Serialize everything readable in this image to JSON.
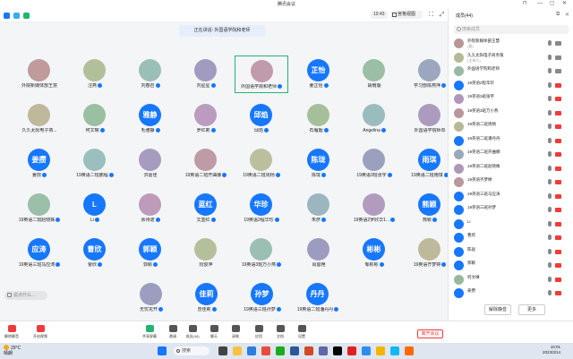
{
  "window": {
    "title": "腾讯会议"
  },
  "toolbar": {
    "timer": "10:43",
    "view_label": "宫格视图"
  },
  "speaking_banner": "正在讲话: 外国语学院和老师",
  "grid": {
    "rows": [
      [
        {
          "name": "外院新媒体部王慧",
          "avatar": "img",
          "hand": false
        },
        {
          "name": "汪燕",
          "avatar": "img",
          "hand": true
        },
        {
          "name": "刘春召",
          "avatar": "img",
          "hand": true
        },
        {
          "name": "刘星星",
          "avatar": "img",
          "hand": true
        },
        {
          "name": "外国语学院和老师",
          "avatar": "img",
          "hand": true,
          "selected": true
        },
        {
          "name": "姜芷怡",
          "avatar": "芷怡",
          "hand": true
        },
        {
          "name": "胡雨璇",
          "avatar": "img",
          "hand": false
        },
        {
          "name": "学习部陈燕萍",
          "avatar": "img",
          "hand": true
        }
      ],
      [
        {
          "name": "久久太阳电子商...",
          "avatar": "img",
          "hand": false
        },
        {
          "name": "何文琳",
          "avatar": "img",
          "hand": true
        },
        {
          "name": "毛雅静",
          "avatar": "雅静",
          "hand": true
        },
        {
          "name": "罗红莉",
          "avatar": "img",
          "hand": true
        },
        {
          "name": "邱焰",
          "avatar": "邱焰",
          "hand": true
        },
        {
          "name": "石雁姻",
          "avatar": "img",
          "hand": true
        },
        {
          "name": "Angelina",
          "avatar": "img",
          "hand": true
        },
        {
          "name": "外国语学院师邓",
          "avatar": "img",
          "hand": false
        }
      ],
      [
        {
          "name": "姜攒",
          "avatar": "姜攒",
          "hand": true
        },
        {
          "name": "19英语二班鹏程",
          "avatar": "img",
          "hand": true
        },
        {
          "name": "洪嘉佳",
          "avatar": "img",
          "hand": false
        },
        {
          "name": "19英语二班开曲娜",
          "avatar": "img",
          "hand": true
        },
        {
          "name": "19英语二班周杨",
          "avatar": "img",
          "hand": true
        },
        {
          "name": "陈珑",
          "avatar": "陈珑",
          "hand": true
        },
        {
          "name": "19英语3班张宇",
          "avatar": "img",
          "hand": true
        },
        {
          "name": "19英语二班雨琪",
          "avatar": "雨琪",
          "hand": true
        }
      ],
      [
        {
          "name": "19英语二班赵晓姝",
          "avatar": "img",
          "hand": true
        },
        {
          "name": "Li",
          "avatar": "L",
          "hand": true
        },
        {
          "name": "余诗诺",
          "avatar": "img",
          "hand": true
        },
        {
          "name": "文蓝红",
          "avatar": "蓝红",
          "hand": true
        },
        {
          "name": "19英语2程华珍",
          "avatar": "华珍",
          "hand": true
        },
        {
          "name": "朱彦",
          "avatar": "img",
          "hand": true
        },
        {
          "name": "19英语2罗欣华1...",
          "avatar": "img",
          "hand": true
        },
        {
          "name": "熊颖",
          "avatar": "熊颖",
          "hand": true
        }
      ],
      [
        {
          "name": "19英语三班马应涛",
          "avatar": "应涛",
          "hand": true
        },
        {
          "name": "曹欣",
          "avatar": "曹欣",
          "hand": true
        },
        {
          "name": "郭颖",
          "avatar": "郭颖",
          "hand": true
        },
        {
          "name": "阮俊萍",
          "avatar": "img",
          "hand": false
        },
        {
          "name": "19英语3班万小燕",
          "avatar": "img",
          "hand": true
        },
        {
          "name": "肖蓉艳",
          "avatar": "img",
          "hand": false
        },
        {
          "name": "邹彬彬",
          "avatar": "彬彬",
          "hand": true
        },
        {
          "name": "19英语齐梦婷",
          "avatar": "img",
          "hand": true
        }
      ],
      [
        {
          "name": "无忧花开",
          "avatar": "img",
          "hand": true
        },
        {
          "name": "曾佳莉",
          "avatar": "佳莉",
          "hand": true
        },
        {
          "name": "19英语三班孙梦",
          "avatar": "孙梦",
          "hand": true
        },
        {
          "name": "19英语二班潘丹丹",
          "avatar": "丹丹",
          "hand": true
        }
      ]
    ]
  },
  "chat_input": {
    "placeholder": "说点什么..."
  },
  "bottom": {
    "items": [
      {
        "label": "解除静音",
        "icon": "mic-icon"
      },
      {
        "label": "开启视频",
        "icon": "camera-icon"
      },
      {
        "label": "共享屏幕",
        "icon": "share-screen-icon"
      },
      {
        "label": "邀请",
        "icon": "invite-icon"
      },
      {
        "label": "成员(44)",
        "icon": "members-icon"
      },
      {
        "label": "聊天",
        "icon": "chat-icon"
      },
      {
        "label": "录制",
        "icon": "record-icon"
      },
      {
        "label": "应用",
        "icon": "apps-icon"
      },
      {
        "label": "文档",
        "icon": "doc-icon"
      },
      {
        "label": "设置",
        "icon": "settings-icon"
      }
    ],
    "leave": "离开会议"
  },
  "panel": {
    "title": "成员(44)",
    "search_placeholder": "搜索成员",
    "members": [
      {
        "name": "外院新媒体部王慧",
        "sub": "(我)",
        "av": "img"
      },
      {
        "name": "久久太阳电子商务策",
        "sub": "(主持人)",
        "av": "img"
      },
      {
        "name": "外国语学院和老师",
        "sub": "",
        "av": "img"
      },
      {
        "name": "19英语2程华珍",
        "sub": "",
        "av": "blue"
      },
      {
        "name": "19英语3班张宇",
        "sub": "",
        "av": "img"
      },
      {
        "name": "19英语3班万小燕",
        "sub": "",
        "av": "img"
      },
      {
        "name": "19英语二班周杨",
        "sub": "",
        "av": "img"
      },
      {
        "name": "19英语二班潘丹丹",
        "sub": "",
        "av": "blue"
      },
      {
        "name": "19英语二班开曲娜",
        "sub": "",
        "av": "img"
      },
      {
        "name": "19英语二班赵晓姝",
        "sub": "",
        "av": "img"
      },
      {
        "name": "19英语齐梦婷",
        "sub": "",
        "av": "img"
      },
      {
        "name": "19英语三班马应涛",
        "sub": "",
        "av": "blue"
      },
      {
        "name": "19英语三班孙梦",
        "sub": "",
        "av": "blue"
      },
      {
        "name": "Li",
        "sub": "",
        "av": "blue"
      },
      {
        "name": "曹欣",
        "sub": "",
        "av": "blue"
      },
      {
        "name": "陈珑",
        "sub": "",
        "av": "blue"
      },
      {
        "name": "郭颖",
        "sub": "",
        "av": "blue"
      },
      {
        "name": "何文琳",
        "sub": "",
        "av": "img"
      },
      {
        "name": "姜攒",
        "sub": "",
        "av": "blue"
      }
    ],
    "unmute_all": "解除静音",
    "more": "更多"
  },
  "taskbar": {
    "temp": "29°C",
    "weather": "晴朗",
    "search": "搜索",
    "time": "10:01",
    "date": "2023/3/14"
  },
  "colors": {
    "accent": "#1677ff",
    "danger": "#f23a3a",
    "selected": "#22b573"
  }
}
